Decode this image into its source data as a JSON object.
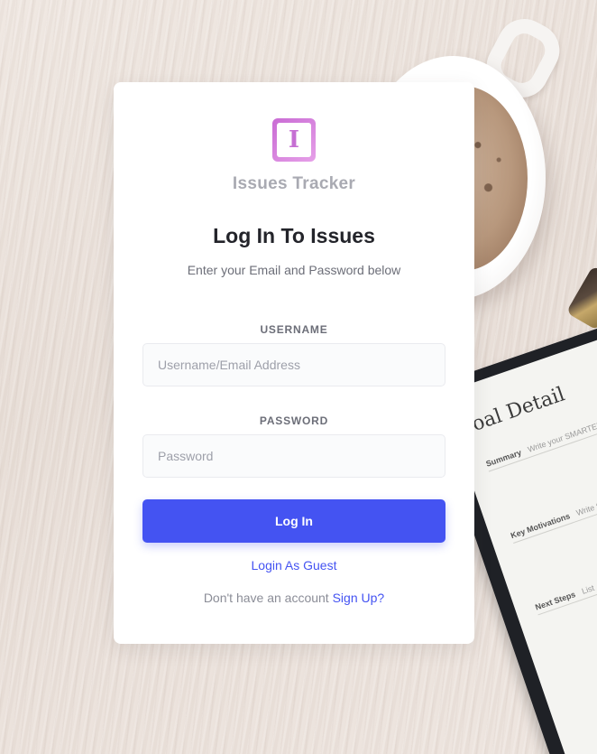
{
  "brand": {
    "name": "Issues Tracker",
    "logo_letter": "I"
  },
  "login": {
    "title": "Log In To Issues",
    "subtitle": "Enter your Email and Password below",
    "username_label": "USERNAME",
    "username_placeholder": "Username/Email Address",
    "username_value": "",
    "password_label": "PASSWORD",
    "password_placeholder": "Password",
    "password_value": "",
    "submit_label": "Log In",
    "guest_link": "Login As Guest",
    "signup_prompt": "Don't have an account",
    "signup_link": "Sign Up?"
  },
  "background": {
    "notebook_title": "oal Detail",
    "notebook_rows": [
      {
        "label": "Summary",
        "hint": "Write your SMARTER"
      },
      {
        "label": "Key Motivations",
        "hint": "Write the"
      },
      {
        "label": "Next Steps",
        "hint": "List"
      }
    ]
  },
  "colors": {
    "accent": "#4453f2",
    "logo": "#c96bd4",
    "heading": "#23242a",
    "muted": "#6c6e78"
  }
}
